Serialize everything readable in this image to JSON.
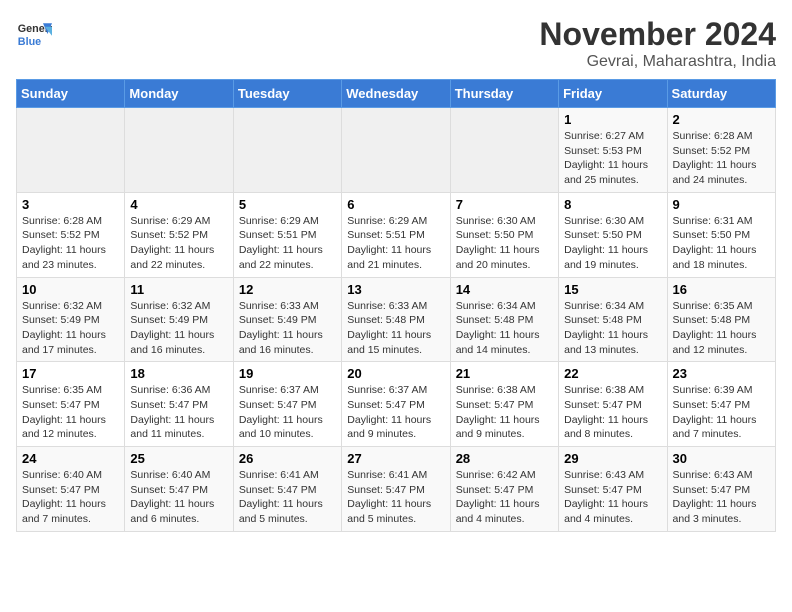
{
  "header": {
    "logo_line1": "General",
    "logo_line2": "Blue",
    "month": "November 2024",
    "location": "Gevrai, Maharashtra, India"
  },
  "days_of_week": [
    "Sunday",
    "Monday",
    "Tuesday",
    "Wednesday",
    "Thursday",
    "Friday",
    "Saturday"
  ],
  "weeks": [
    [
      {
        "day": "",
        "info": ""
      },
      {
        "day": "",
        "info": ""
      },
      {
        "day": "",
        "info": ""
      },
      {
        "day": "",
        "info": ""
      },
      {
        "day": "",
        "info": ""
      },
      {
        "day": "1",
        "info": "Sunrise: 6:27 AM\nSunset: 5:53 PM\nDaylight: 11 hours and 25 minutes."
      },
      {
        "day": "2",
        "info": "Sunrise: 6:28 AM\nSunset: 5:52 PM\nDaylight: 11 hours and 24 minutes."
      }
    ],
    [
      {
        "day": "3",
        "info": "Sunrise: 6:28 AM\nSunset: 5:52 PM\nDaylight: 11 hours and 23 minutes."
      },
      {
        "day": "4",
        "info": "Sunrise: 6:29 AM\nSunset: 5:52 PM\nDaylight: 11 hours and 22 minutes."
      },
      {
        "day": "5",
        "info": "Sunrise: 6:29 AM\nSunset: 5:51 PM\nDaylight: 11 hours and 22 minutes."
      },
      {
        "day": "6",
        "info": "Sunrise: 6:29 AM\nSunset: 5:51 PM\nDaylight: 11 hours and 21 minutes."
      },
      {
        "day": "7",
        "info": "Sunrise: 6:30 AM\nSunset: 5:50 PM\nDaylight: 11 hours and 20 minutes."
      },
      {
        "day": "8",
        "info": "Sunrise: 6:30 AM\nSunset: 5:50 PM\nDaylight: 11 hours and 19 minutes."
      },
      {
        "day": "9",
        "info": "Sunrise: 6:31 AM\nSunset: 5:50 PM\nDaylight: 11 hours and 18 minutes."
      }
    ],
    [
      {
        "day": "10",
        "info": "Sunrise: 6:32 AM\nSunset: 5:49 PM\nDaylight: 11 hours and 17 minutes."
      },
      {
        "day": "11",
        "info": "Sunrise: 6:32 AM\nSunset: 5:49 PM\nDaylight: 11 hours and 16 minutes."
      },
      {
        "day": "12",
        "info": "Sunrise: 6:33 AM\nSunset: 5:49 PM\nDaylight: 11 hours and 16 minutes."
      },
      {
        "day": "13",
        "info": "Sunrise: 6:33 AM\nSunset: 5:48 PM\nDaylight: 11 hours and 15 minutes."
      },
      {
        "day": "14",
        "info": "Sunrise: 6:34 AM\nSunset: 5:48 PM\nDaylight: 11 hours and 14 minutes."
      },
      {
        "day": "15",
        "info": "Sunrise: 6:34 AM\nSunset: 5:48 PM\nDaylight: 11 hours and 13 minutes."
      },
      {
        "day": "16",
        "info": "Sunrise: 6:35 AM\nSunset: 5:48 PM\nDaylight: 11 hours and 12 minutes."
      }
    ],
    [
      {
        "day": "17",
        "info": "Sunrise: 6:35 AM\nSunset: 5:47 PM\nDaylight: 11 hours and 12 minutes."
      },
      {
        "day": "18",
        "info": "Sunrise: 6:36 AM\nSunset: 5:47 PM\nDaylight: 11 hours and 11 minutes."
      },
      {
        "day": "19",
        "info": "Sunrise: 6:37 AM\nSunset: 5:47 PM\nDaylight: 11 hours and 10 minutes."
      },
      {
        "day": "20",
        "info": "Sunrise: 6:37 AM\nSunset: 5:47 PM\nDaylight: 11 hours and 9 minutes."
      },
      {
        "day": "21",
        "info": "Sunrise: 6:38 AM\nSunset: 5:47 PM\nDaylight: 11 hours and 9 minutes."
      },
      {
        "day": "22",
        "info": "Sunrise: 6:38 AM\nSunset: 5:47 PM\nDaylight: 11 hours and 8 minutes."
      },
      {
        "day": "23",
        "info": "Sunrise: 6:39 AM\nSunset: 5:47 PM\nDaylight: 11 hours and 7 minutes."
      }
    ],
    [
      {
        "day": "24",
        "info": "Sunrise: 6:40 AM\nSunset: 5:47 PM\nDaylight: 11 hours and 7 minutes."
      },
      {
        "day": "25",
        "info": "Sunrise: 6:40 AM\nSunset: 5:47 PM\nDaylight: 11 hours and 6 minutes."
      },
      {
        "day": "26",
        "info": "Sunrise: 6:41 AM\nSunset: 5:47 PM\nDaylight: 11 hours and 5 minutes."
      },
      {
        "day": "27",
        "info": "Sunrise: 6:41 AM\nSunset: 5:47 PM\nDaylight: 11 hours and 5 minutes."
      },
      {
        "day": "28",
        "info": "Sunrise: 6:42 AM\nSunset: 5:47 PM\nDaylight: 11 hours and 4 minutes."
      },
      {
        "day": "29",
        "info": "Sunrise: 6:43 AM\nSunset: 5:47 PM\nDaylight: 11 hours and 4 minutes."
      },
      {
        "day": "30",
        "info": "Sunrise: 6:43 AM\nSunset: 5:47 PM\nDaylight: 11 hours and 3 minutes."
      }
    ]
  ]
}
